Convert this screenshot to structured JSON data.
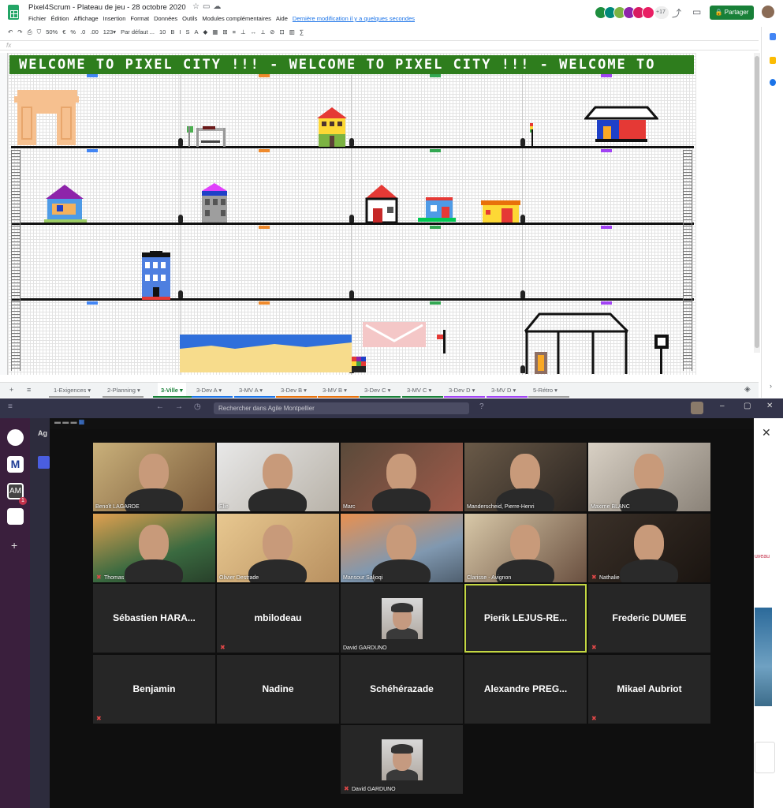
{
  "sheets": {
    "doc_title": "Pixel4Scrum - Plateau de jeu - 28 octobre 2020",
    "menu": [
      "Fichier",
      "Édition",
      "Affichage",
      "Insertion",
      "Format",
      "Données",
      "Outils",
      "Modules complémentaires",
      "Aide"
    ],
    "last_edit": "Dernière modification il y a quelques secondes",
    "collab_more": "+17",
    "share_label": "Partager",
    "toolbar": [
      "↶",
      "↷",
      "⎙",
      "⛉",
      "50%",
      "€",
      "%",
      ".0",
      ".00",
      "123▾",
      "Par défaut ...",
      "10",
      "B",
      "I",
      "S",
      "A",
      "◆",
      "▦",
      "⊞",
      "≡",
      "⊥",
      "↔",
      "⟂",
      "⊘",
      "⊡",
      "▥",
      "∑"
    ],
    "fx_label": "fx",
    "banner": "WELCOME TO PIXEL CITY !!! - WELCOME TO PIXEL CITY !!! - WELCOME TO",
    "tabs": [
      {
        "label": "1-Exigences",
        "color": "#9e9e9e"
      },
      {
        "label": "2-Planning",
        "color": "#9e9e9e"
      },
      {
        "label": "3-Ville",
        "color": "#188038"
      },
      {
        "label": "3-Dev A",
        "color": "#1a73e8"
      },
      {
        "label": "3-MV A",
        "color": "#1a73e8"
      },
      {
        "label": "3-Dev B",
        "color": "#e8710a"
      },
      {
        "label": "3-MV B",
        "color": "#e8710a"
      },
      {
        "label": "3-Dev C",
        "color": "#188038"
      },
      {
        "label": "3-MV C",
        "color": "#188038"
      },
      {
        "label": "3-Dev D",
        "color": "#a142f4"
      },
      {
        "label": "3-MV D",
        "color": "#a142f4"
      },
      {
        "label": "5-Rétro",
        "color": "#9e9e9e"
      }
    ]
  },
  "teams": {
    "search_placeholder": "Rechercher dans Agile Montpellier",
    "rail_badge": "1",
    "rail_team_label": "AM",
    "panel_header": "Ag",
    "panel_side_text": "uveau",
    "participants": [
      {
        "name": "Benoît LAGARDE",
        "type": "video",
        "muted": false
      },
      {
        "name": "Elie",
        "type": "video",
        "muted": false
      },
      {
        "name": "Marc",
        "type": "video",
        "muted": false
      },
      {
        "name": "Manderscheid, Pierre-Henri",
        "type": "video",
        "muted": false
      },
      {
        "name": "Maxime BLANC",
        "type": "video",
        "muted": false
      },
      {
        "name": "Thomas",
        "type": "video",
        "muted": true
      },
      {
        "name": "Olivier Destrade",
        "type": "video",
        "muted": false
      },
      {
        "name": "Mansour Saljoqi",
        "type": "video",
        "muted": false
      },
      {
        "name": "Clarisse - Avignon",
        "type": "video",
        "muted": false
      },
      {
        "name": "Nathalie",
        "type": "video",
        "muted": true
      },
      {
        "name": "Sébastien HARA...",
        "type": "text",
        "muted": false
      },
      {
        "name": "mbilodeau",
        "type": "text",
        "muted": true
      },
      {
        "name": "David GARDUNO",
        "type": "photo",
        "muted": false
      },
      {
        "name": "Pierik LEJUS-RE...",
        "type": "text",
        "muted": false,
        "selected": true
      },
      {
        "name": "Frederic DUMEE",
        "type": "text",
        "muted": true
      },
      {
        "name": "Benjamin",
        "type": "text",
        "muted": true
      },
      {
        "name": "Nadine",
        "type": "text",
        "muted": false
      },
      {
        "name": "Schéhérazade",
        "type": "text",
        "muted": false
      },
      {
        "name": "Alexandre PREG...",
        "type": "text",
        "muted": false
      },
      {
        "name": "Mikael Aubriot",
        "type": "text",
        "muted": true
      },
      {
        "name": "David GARDUNO",
        "type": "photo",
        "muted": true
      }
    ]
  }
}
